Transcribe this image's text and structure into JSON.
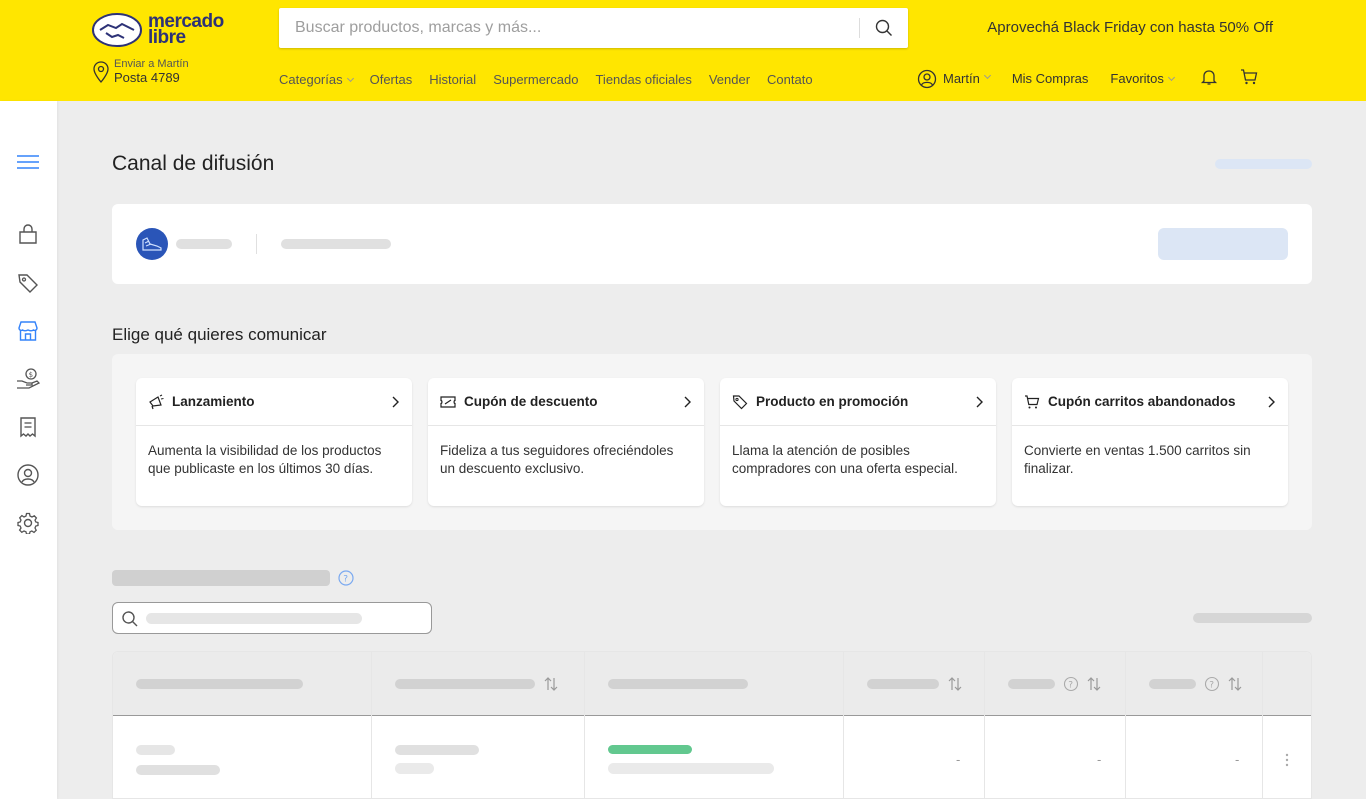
{
  "header": {
    "logo_line1": "mercado",
    "logo_line2": "libre",
    "search_placeholder": "Buscar productos, marcas y más...",
    "promo": "Aprovechá Black Friday con hasta 50% Off",
    "ship_label": "Enviar a Martín",
    "ship_address": "Posta 4789",
    "nav": [
      "Categorías",
      "Ofertas",
      "Historial",
      "Supermercado",
      "Tiendas oficiales",
      "Vender",
      "Contato"
    ],
    "user_name": "Martín",
    "my_purchases": "Mis Compras",
    "favorites": "Favoritos"
  },
  "page": {
    "title": "Canal de difusión",
    "section_title": "Elige qué quieres comunicar"
  },
  "options": [
    {
      "icon": "megaphone-icon",
      "label": "Lanzamiento",
      "desc": "Aumenta la visibilidad de los productos que publicaste en los últimos 30 días."
    },
    {
      "icon": "coupon-icon",
      "label": "Cupón de descuento",
      "desc": "Fideliza a tus seguidores ofreciéndoles un descuento exclusivo."
    },
    {
      "icon": "tag-icon",
      "label": "Producto en promoción",
      "desc": "Llama la atención de posibles compradores con una oferta especial."
    },
    {
      "icon": "cart-icon",
      "label": "Cupón carritos abandonados",
      "desc": "Convierte en ventas 1.500 carritos sin finalizar."
    }
  ],
  "table": {
    "empty_cells": [
      "-",
      "-",
      "-"
    ]
  },
  "colors": {
    "header_bg": "#ffe600",
    "accent_blue": "#3483fa",
    "status_green": "#62c88f"
  }
}
